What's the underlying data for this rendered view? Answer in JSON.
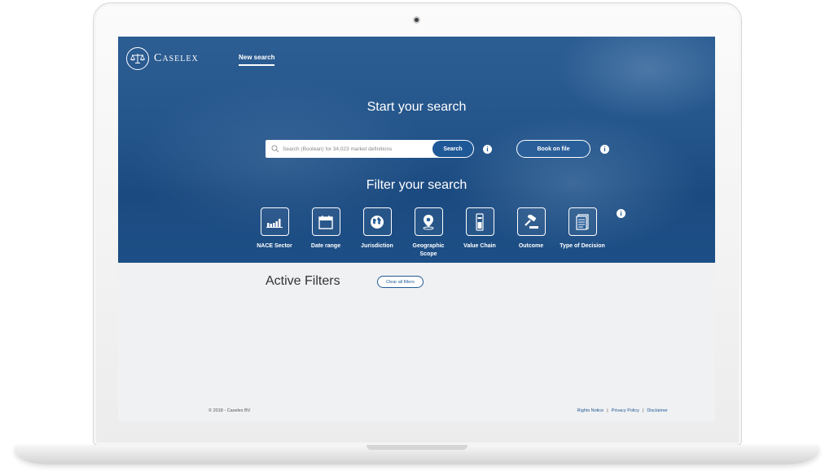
{
  "app": {
    "brand": "Caselex",
    "nav_new_search": "New search"
  },
  "hero": {
    "start_title": "Start your search",
    "search_placeholder": "Search (Boolean) for 34,023 market definitions",
    "search_button": "Search",
    "book_on_file_button": "Book on file",
    "info_glyph": "i",
    "filter_title": "Filter your search"
  },
  "filters": [
    {
      "label": "NACE Sector",
      "icon": "bar-chart-icon"
    },
    {
      "label": "Date range",
      "icon": "calendar-icon"
    },
    {
      "label": "Jurisdiction",
      "icon": "globe-icon"
    },
    {
      "label": "Geographic Scope",
      "icon": "map-pin-icon"
    },
    {
      "label": "Value Chain",
      "icon": "value-chain-icon"
    },
    {
      "label": "Outcome",
      "icon": "gavel-icon"
    },
    {
      "label": "Type of Decision",
      "icon": "document-icon"
    }
  ],
  "active_filters": {
    "title": "Active Filters",
    "clear_button": "Clear all filters"
  },
  "footer": {
    "copyright": "© 2018 - Caselex BV",
    "links": [
      "Rights Notice",
      "Privacy Policy",
      "Disclaimer"
    ],
    "separator": "|"
  },
  "colors": {
    "brand_blue": "#1f5897",
    "hero_blue": "#24558b",
    "page_bg": "#f0f1f2"
  }
}
